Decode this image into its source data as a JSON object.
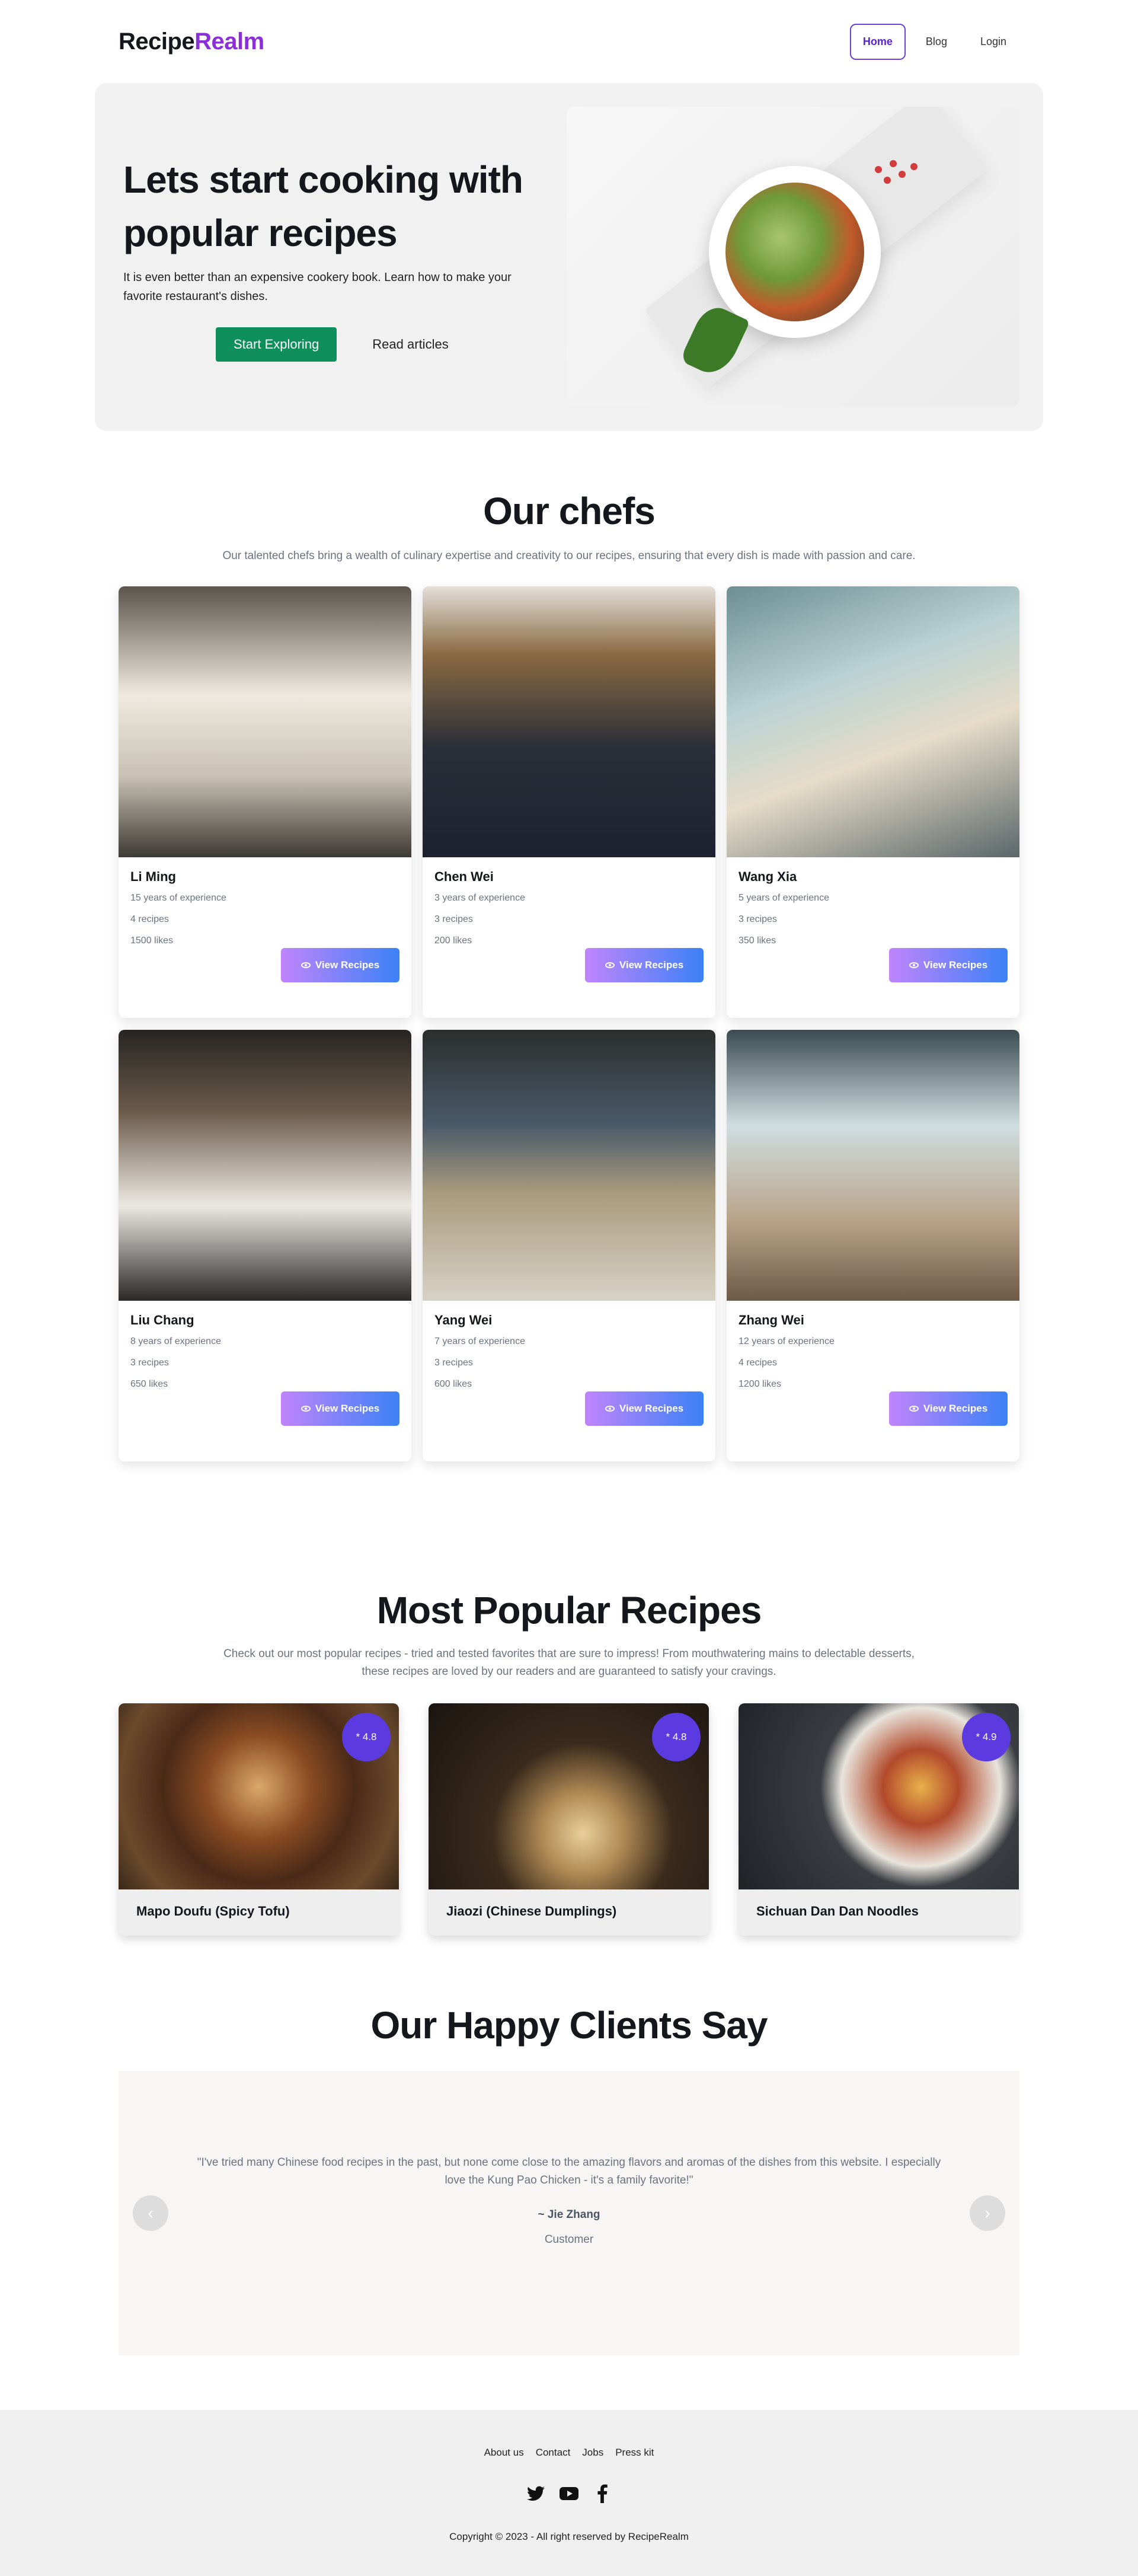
{
  "nav": {
    "logo_part1": "Recipe",
    "logo_part2": "Realm",
    "links": [
      {
        "label": "Home"
      },
      {
        "label": "Blog"
      },
      {
        "label": "Login"
      }
    ]
  },
  "hero": {
    "title": "Lets start cooking with popular recipes",
    "description": "It is even better than an expensive cookery book. Learn how to make your favorite restaurant's dishes.",
    "primary_button": "Start Exploring",
    "secondary_button": "Read articles"
  },
  "chefs": {
    "title": "Our chefs",
    "subtitle": "Our talented chefs bring a wealth of culinary expertise and creativity to our recipes, ensuring that every dish is made with passion and care.",
    "button_label": "View Recipes",
    "items": [
      {
        "name": "Li Ming",
        "experience": "15 years of experience",
        "recipes": "4 recipes",
        "likes": "1500 likes"
      },
      {
        "name": "Chen Wei",
        "experience": "3 years of experience",
        "recipes": "3 recipes",
        "likes": "200 likes"
      },
      {
        "name": "Wang Xia",
        "experience": "5 years of experience",
        "recipes": "3 recipes",
        "likes": "350 likes"
      },
      {
        "name": "Liu Chang",
        "experience": "8 years of experience",
        "recipes": "3 recipes",
        "likes": "650 likes"
      },
      {
        "name": "Yang Wei",
        "experience": "7 years of experience",
        "recipes": "3 recipes",
        "likes": "600 likes"
      },
      {
        "name": "Zhang Wei",
        "experience": "12 years of experience",
        "recipes": "4 recipes",
        "likes": "1200 likes"
      }
    ]
  },
  "recipes": {
    "title": "Most Popular Recipes",
    "subtitle_line1": "Check out our most popular recipes - tried and tested favorites that are sure to impress! From mouthwatering mains to delectable desserts,",
    "subtitle_line2": "these recipes are loved by our readers and are guaranteed to satisfy your cravings.",
    "items": [
      {
        "name": "Mapo Doufu (Spicy Tofu)",
        "rating": "* 4.8"
      },
      {
        "name": "Jiaozi (Chinese Dumplings)",
        "rating": "* 4.8"
      },
      {
        "name": "Sichuan Dan Dan Noodles",
        "rating": "* 4.9"
      }
    ]
  },
  "testimonials": {
    "title": "Our Happy Clients Say",
    "quote": "\"I've tried many Chinese food recipes in the past, but none come close to the amazing flavors and aromas of the dishes from this website. I especially love the Kung Pao Chicken - it's a family favorite!\"",
    "author": "~ Jie Zhang",
    "role": "Customer",
    "prev": "‹",
    "next": "›"
  },
  "footer": {
    "links": [
      {
        "label": "About us"
      },
      {
        "label": "Contact"
      },
      {
        "label": "Jobs"
      },
      {
        "label": "Press kit"
      }
    ],
    "social": [
      "twitter-icon",
      "youtube-icon",
      "facebook-icon"
    ],
    "copyright": "Copyright © 2023 - All right reserved by RecipeRealm"
  },
  "colors": {
    "brand": "#8b2fd8",
    "primary_button": "#0e8f5b",
    "rating_badge": "#5b3be0",
    "view_button_gradient": [
      "#c084fc",
      "#3b82f6"
    ]
  }
}
